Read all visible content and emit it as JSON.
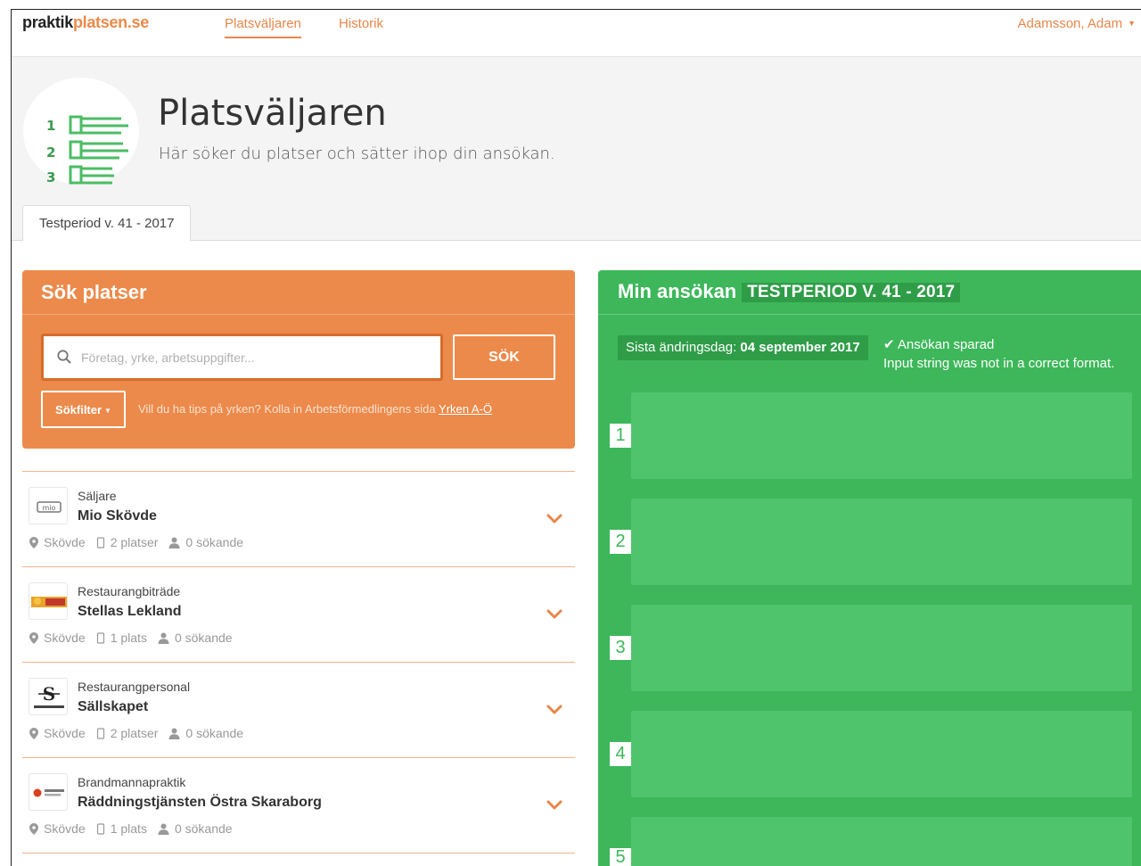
{
  "brand": {
    "part1": "praktik",
    "part2": "platsen.se"
  },
  "nav": {
    "items": [
      {
        "label": "Platsväljaren"
      },
      {
        "label": "Historik"
      }
    ],
    "user": "Adamsson, Adam"
  },
  "header": {
    "icon_numbers": [
      "1",
      "2",
      "3"
    ],
    "title": "Platsväljaren",
    "subtitle": "Här söker du platser och sätter ihop din ansökan.",
    "period_tab": "Testperiod v. 41 - 2017"
  },
  "search": {
    "title": "Sök platser",
    "placeholder": "Företag, yrke, arbetsuppgifter...",
    "value": "",
    "button": "SÖK",
    "filter": "Sökfilter",
    "tip": "Vill du ha tips på yrken? Kolla in Arbetsförmedlingens sida ",
    "tip_link": "Yrken A-Ö"
  },
  "listings": [
    {
      "role": "Säljare",
      "company": "Mio Skövde",
      "city": "Skövde",
      "places": "2 platser",
      "applicants": "0 sökande"
    },
    {
      "role": "Restaurangbiträde",
      "company": "Stellas Lekland",
      "city": "Skövde",
      "places": "1 plats",
      "applicants": "0 sökande"
    },
    {
      "role": "Restaurangpersonal",
      "company": "Sällskapet",
      "city": "Skövde",
      "places": "2 platser",
      "applicants": "0 sökande"
    },
    {
      "role": "Brandmannapraktik",
      "company": "Räddningstjänsten Östra Skaraborg",
      "city": "Skövde",
      "places": "1 plats",
      "applicants": "0 sökande"
    }
  ],
  "application": {
    "title": "Min ansökan",
    "period": "TESTPERIOD V. 41 - 2017",
    "deadline_label": "Sista ändringsdag:",
    "deadline_value": "04 september 2017",
    "saved": "Ansökan sparad",
    "error": "Input string was not in a correct format.",
    "slots": [
      "1",
      "2",
      "3",
      "4",
      "5"
    ]
  },
  "colors": {
    "orange": "#ec8a4b",
    "green": "#3db75a",
    "slot_green": "#4fc46d"
  }
}
